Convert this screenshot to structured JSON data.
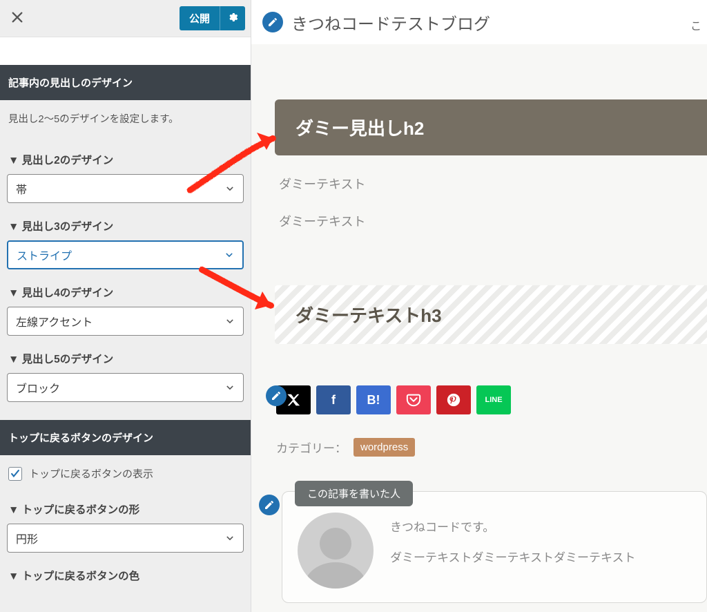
{
  "sidebar": {
    "publish_label": "公開",
    "section_heading_design": "記事内の見出しのデザイン",
    "heading_design_desc": "見出し2〜5のデザインを設定します。",
    "h2": {
      "label": "▼ 見出し2のデザイン",
      "value": "帯"
    },
    "h3": {
      "label": "▼ 見出し3のデザイン",
      "value": "ストライプ"
    },
    "h4": {
      "label": "▼ 見出し4のデザイン",
      "value": "左線アクセント"
    },
    "h5": {
      "label": "▼ 見出し5のデザイン",
      "value": "ブロック"
    },
    "section_top_button": "トップに戻るボタンのデザイン",
    "show_top_btn_label": "トップに戻るボタンの表示",
    "top_shape": {
      "label": "▼ トップに戻るボタンの形",
      "value": "円形"
    },
    "top_color_label": "▼ トップに戻るボタンの色"
  },
  "preview": {
    "site_title": "きつねコードテストブログ",
    "head_right": "こ",
    "h2_text": "ダミー見出しh2",
    "p1": "ダミーテキスト",
    "p2": "ダミーテキスト",
    "h3_text": "ダミーテキストh3",
    "share": {
      "x": "X",
      "f": "f",
      "b": "B!",
      "line": "LINE"
    },
    "category_label": "カテゴリー：",
    "category_tag": "wordpress",
    "author_tab": "この記事を書いた人",
    "author_line1": "きつねコードです。",
    "author_line2": "ダミーテキストダミーテキストダミーテキスト"
  }
}
